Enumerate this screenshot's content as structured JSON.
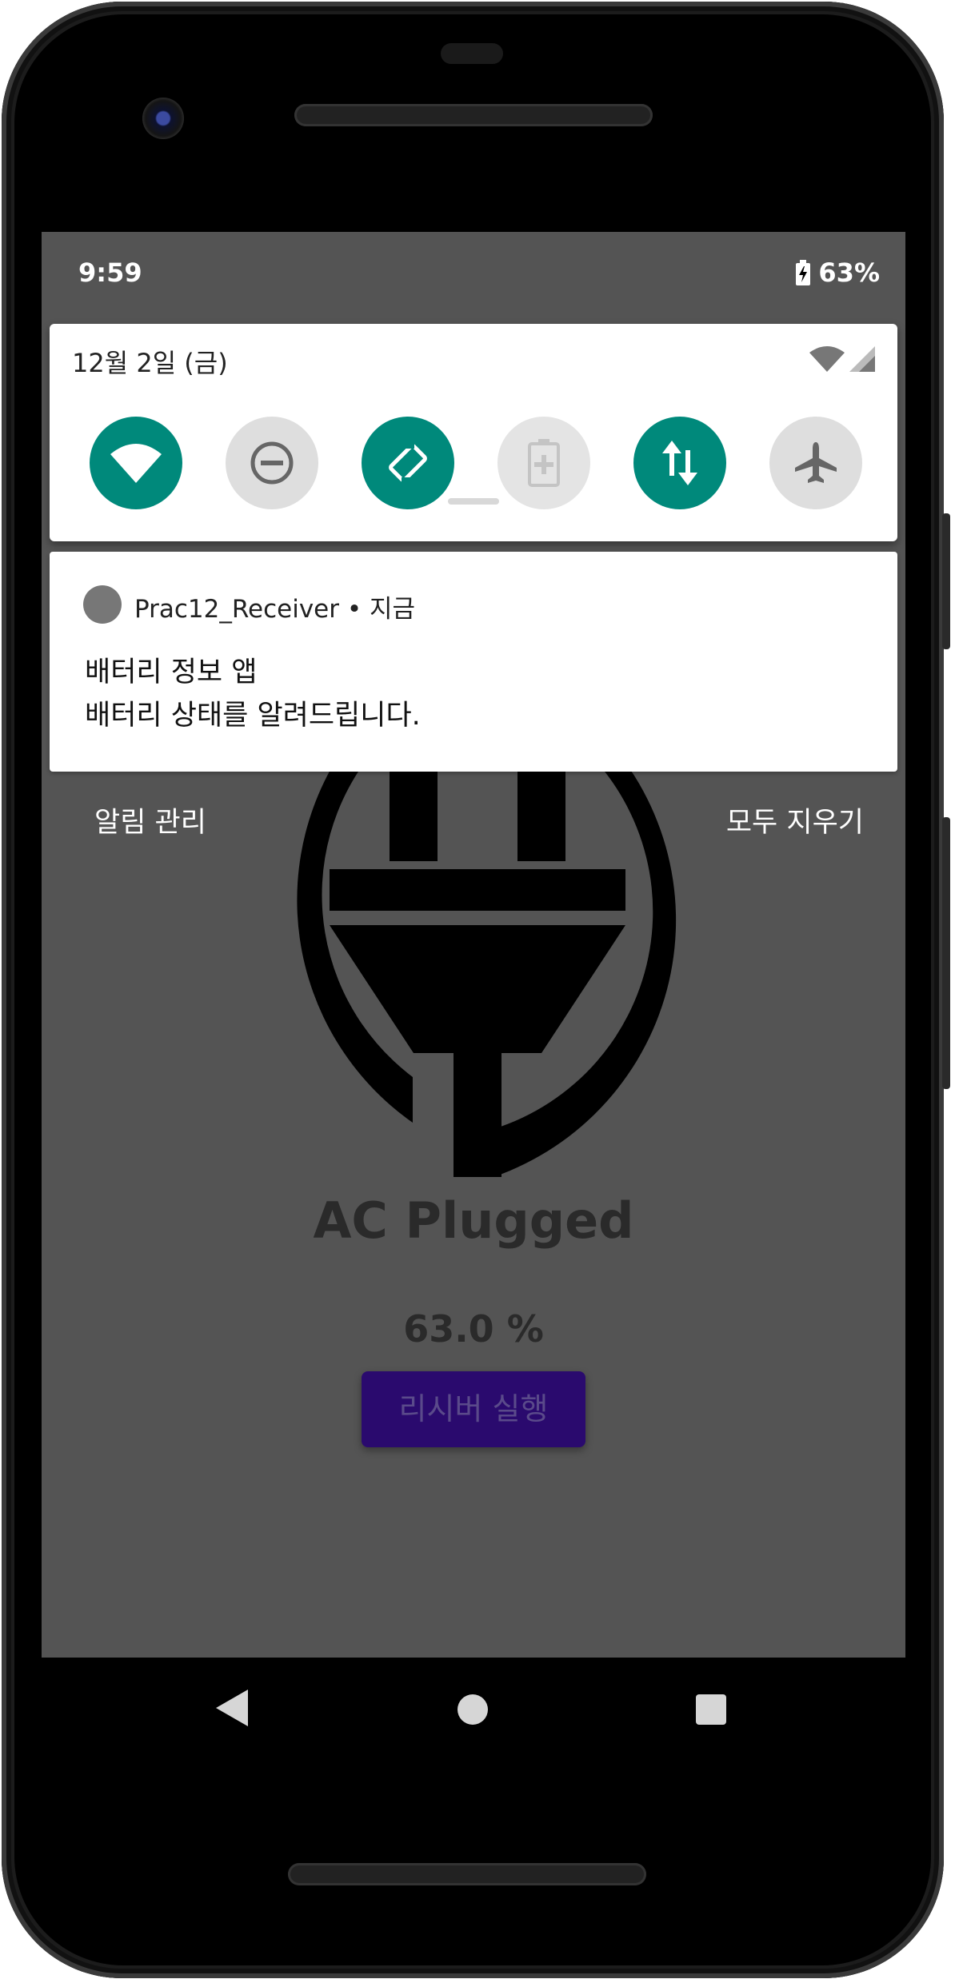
{
  "status_bar": {
    "time": "9:59",
    "battery_percent": "63%",
    "battery_icon": "battery-charging-icon"
  },
  "quick_settings": {
    "date": "12월 2일 (금)",
    "signal_icons": [
      "wifi-icon",
      "cell-signal-icon"
    ],
    "tiles": [
      {
        "name": "wifi",
        "icon": "wifi-icon",
        "state": "on"
      },
      {
        "name": "do-not-disturb",
        "icon": "minus-circle-icon",
        "state": "off"
      },
      {
        "name": "auto-rotate",
        "icon": "rotate-icon",
        "state": "on"
      },
      {
        "name": "battery-saver",
        "icon": "battery-plus-icon",
        "state": "disabled"
      },
      {
        "name": "mobile-data",
        "icon": "data-arrows-icon",
        "state": "on"
      },
      {
        "name": "airplane-mode",
        "icon": "airplane-icon",
        "state": "off"
      }
    ],
    "colors": {
      "accent": "#00897b"
    }
  },
  "notification": {
    "app_name": "Prac12_Receiver",
    "separator": "•",
    "time": "지금",
    "title": "배터리 정보 앱",
    "text": "배터리 상태를 알려드립니다."
  },
  "notification_actions": {
    "manage_label": "알림 관리",
    "clear_all_label": "모두 지우기"
  },
  "app": {
    "image_icon": "ac-plug-icon",
    "status_text": "AC Plugged",
    "percent_text": "63.0 %",
    "button_label": "리시버 실행",
    "button_color": "#2a0a6e"
  },
  "nav_bar": {
    "icons": [
      "back-icon",
      "home-icon",
      "recents-icon"
    ]
  }
}
